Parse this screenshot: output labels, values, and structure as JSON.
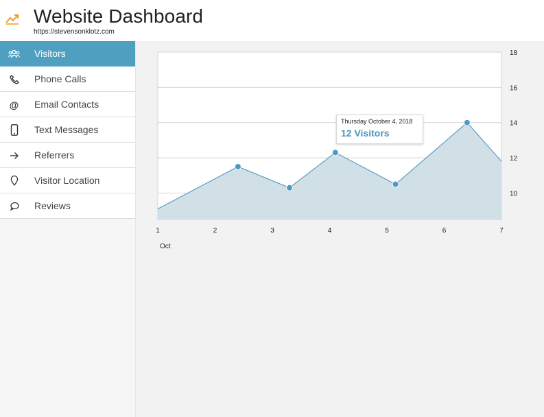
{
  "header": {
    "title": "Website Dashboard",
    "subtitle": "https://stevensonklotz.com"
  },
  "colors": {
    "accent": "#4fa0c0",
    "logo": "#f39a1e",
    "series_line": "#5a9fc6",
    "series_fill": "#d1dfe7",
    "point": "#4f99c3"
  },
  "sidebar": {
    "items": [
      {
        "label": "Visitors",
        "icon": "users-icon",
        "active": true
      },
      {
        "label": "Phone Calls",
        "icon": "phone-icon",
        "active": false
      },
      {
        "label": "Email Contacts",
        "icon": "at-icon",
        "active": false
      },
      {
        "label": "Text Messages",
        "icon": "mobile-icon",
        "active": false
      },
      {
        "label": "Referrers",
        "icon": "arrow-right-icon",
        "active": false
      },
      {
        "label": "Visitor Location",
        "icon": "map-pin-icon",
        "active": false
      },
      {
        "label": "Reviews",
        "icon": "chat-bubble-icon",
        "active": false
      }
    ]
  },
  "tooltip": {
    "date": "Thursday October 4, 2018",
    "value": "12 Visitors"
  },
  "chart_data": {
    "type": "area",
    "x_ticks": [
      "1",
      "2",
      "3",
      "4",
      "5",
      "6",
      "7"
    ],
    "x_sublabel": "Oct",
    "y_ticks": [
      "10",
      "12",
      "14",
      "16",
      "18"
    ],
    "ylim": [
      8.5,
      18
    ],
    "xlim": [
      1,
      7
    ],
    "grid": true,
    "y_axis_side": "right",
    "x": [
      1,
      2.4,
      3.3,
      4.1,
      5.15,
      6.4,
      7
    ],
    "values": [
      9.1,
      11.5,
      10.3,
      12.3,
      10.5,
      14,
      11.8
    ],
    "markers": [
      false,
      true,
      true,
      true,
      true,
      true,
      false
    ]
  }
}
